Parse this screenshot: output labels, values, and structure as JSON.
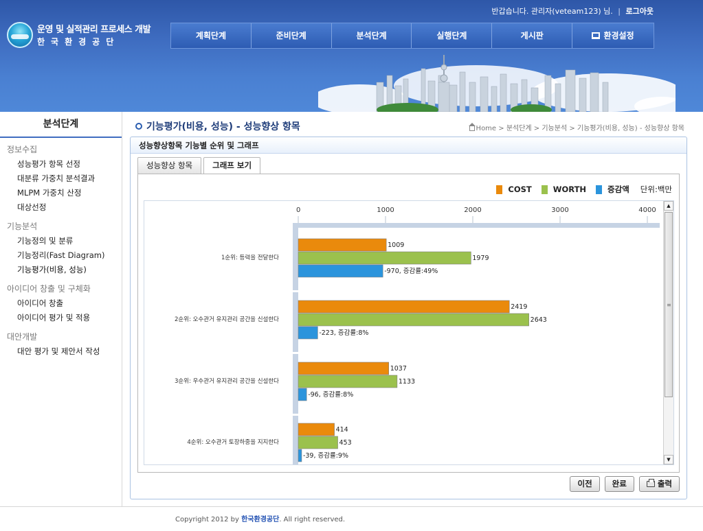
{
  "header": {
    "logo_title": "운영 및 실적관리 프로세스 개발",
    "logo_sub": "한국환경공단",
    "greeting": "반갑습니다. 관리자(veteam123) 님.",
    "separator": "|",
    "logout": "로그아웃",
    "nav": [
      "계획단계",
      "준비단계",
      "분석단계",
      "실행단계",
      "게시판",
      "환경설정"
    ]
  },
  "sidebar": {
    "title": "분석단계",
    "groups": [
      {
        "head": "정보수집",
        "items": [
          "성능평가 항목 선정",
          "대분류 가중치 분석결과",
          "MLPM 가중치 산정",
          "대상선정"
        ]
      },
      {
        "head": "기능분석",
        "items": [
          "기능정의 및 분류",
          "기능정리(Fast Diagram)",
          "기능평가(비용, 성능)"
        ]
      },
      {
        "head": "아이디어 창출 및 구체화",
        "items": [
          "아이디어 창출",
          "아이디어 평가 및 적용"
        ]
      },
      {
        "head": "대안개발",
        "items": [
          "대안 평가 및 제안서 작성"
        ]
      }
    ]
  },
  "page": {
    "title": "기능평가(비용, 성능) - 성능향상 항목",
    "breadcrumb": "Home > 분석단계 > 기능분석 > 기능평가(비용, 성능) - 성능향상 항목"
  },
  "panel": {
    "title": "성능향상항목 기능별 순위 및 그래프",
    "tabs": [
      "성능향상 항목",
      "그래프 보기"
    ],
    "legend": [
      "COST",
      "WORTH",
      "증감액"
    ],
    "unit": "단위:백만",
    "buttons": [
      "이전",
      "완료",
      "출력"
    ]
  },
  "colors": {
    "cost": "#ea8a0c",
    "worth": "#9bc14d",
    "diff": "#2b94dc",
    "axis": "#c6d3e4"
  },
  "chart_data": {
    "type": "bar",
    "orientation": "horizontal",
    "xlim": [
      0,
      4000
    ],
    "ticks": [
      0,
      1000,
      2000,
      3000,
      4000
    ],
    "categories": [
      "1순위: 등력을 전달한다",
      "2순위: 오수관거 유지관리 공간을 신설한다",
      "3순위: 우수관거 유지관리 공간을 신설한다",
      "4순위: 오수관거 토장하중을 지지한다"
    ],
    "series": [
      {
        "name": "COST",
        "values": [
          1009,
          2419,
          1037,
          414
        ]
      },
      {
        "name": "WORTH",
        "values": [
          1979,
          2643,
          1133,
          453
        ]
      },
      {
        "name": "증감액",
        "values": [
          -970,
          -223,
          -96,
          -39
        ]
      }
    ],
    "labels": [
      [
        "1009",
        "1979",
        "-970, 증감률:49%"
      ],
      [
        "2419",
        "2643",
        "-223, 증감률:8%"
      ],
      [
        "1037",
        "1133",
        "-96, 증감률:8%"
      ],
      [
        "414",
        "453",
        "-39, 증감률:9%"
      ]
    ]
  },
  "footer": {
    "prefix": "Copyright 2012 by ",
    "org": "한국환경공단",
    "suffix": ". All right reserved."
  }
}
